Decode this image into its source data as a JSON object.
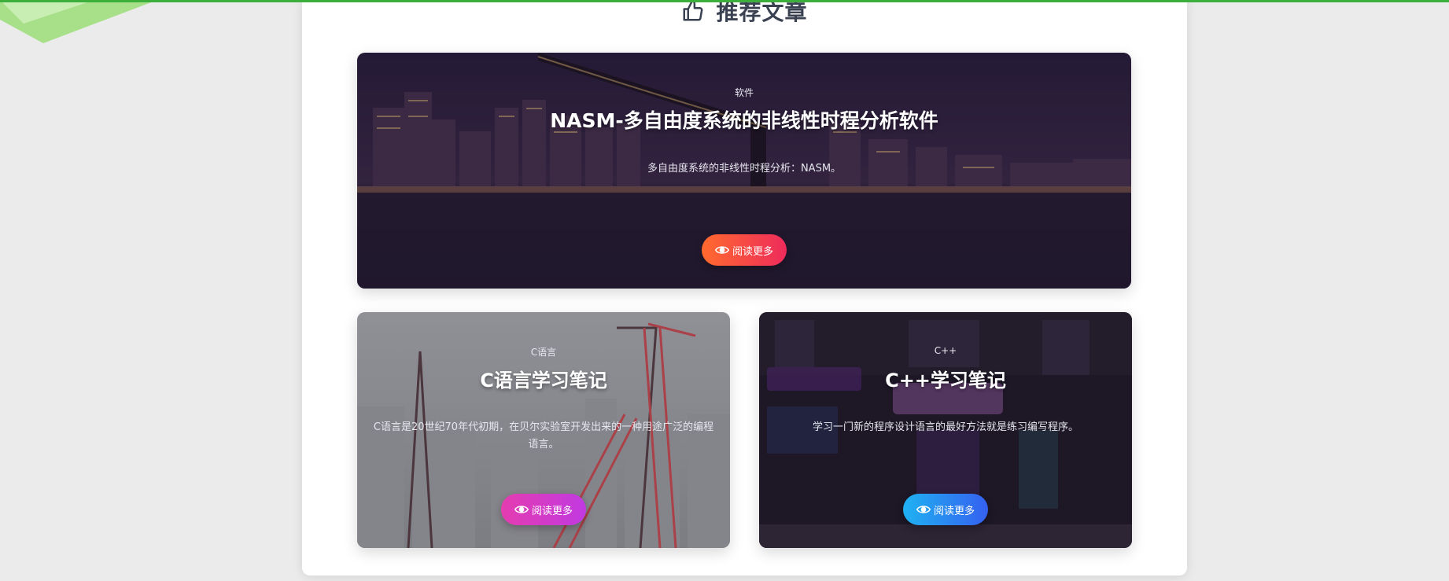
{
  "section": {
    "title": "推荐文章",
    "icon": "thumbs-up-icon"
  },
  "cards": [
    {
      "category": "软件",
      "title": "NASM-多自由度系统的非线性时程分析软件",
      "description": "多自由度系统的非线性时程分析：NASM。",
      "button_label": "阅读更多",
      "button_icon": "eye-icon"
    },
    {
      "category": "C语言",
      "title": "C语言学习笔记",
      "description": "C语言是20世纪70年代初期，在贝尔实验室开发出来的一种用途广泛的编程语言。",
      "button_label": "阅读更多",
      "button_icon": "eye-icon"
    },
    {
      "category": "C++",
      "title": "C++学习笔记",
      "description": "学习一门新的程序设计语言的最好方法就是练习编写程序。",
      "button_label": "阅读更多",
      "button_icon": "eye-icon"
    }
  ],
  "colors": {
    "accent_green": "#3cae3c",
    "button_1": "#ff4d4d",
    "button_2": "#d63bc8",
    "button_3": "#2a8cf2"
  }
}
